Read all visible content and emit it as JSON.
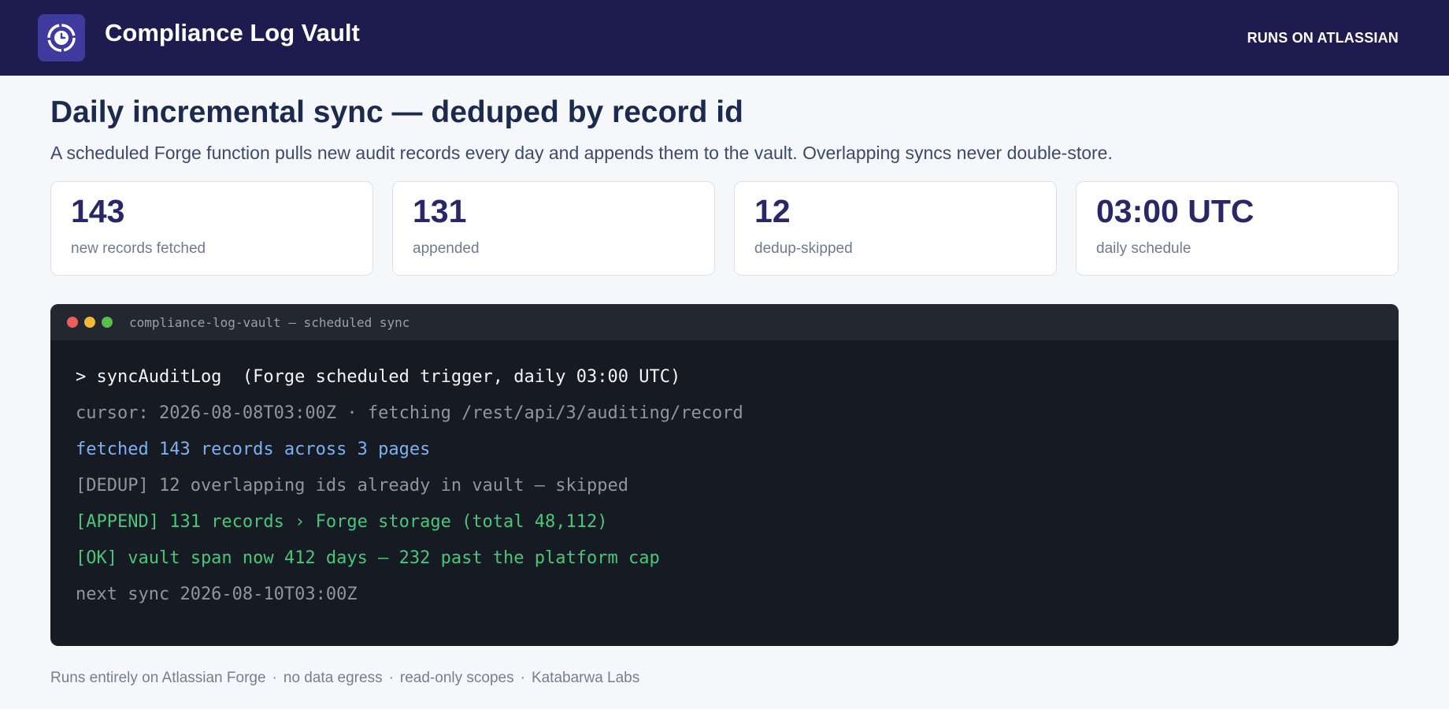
{
  "header": {
    "app_title": "Compliance Log Vault",
    "badge": "RUNS ON ATLASSIAN",
    "logo_icon": "clock-badge-icon",
    "colors": {
      "bar": "#1e1b4f",
      "logo_bg": "#3f3a9e"
    }
  },
  "main": {
    "title": "Daily incremental sync — deduped by record id",
    "subtitle": "A scheduled Forge function pulls new audit records every day and appends them to the vault. Overlapping syncs never double-store."
  },
  "stats": [
    {
      "value": "143",
      "label": "new records fetched"
    },
    {
      "value": "131",
      "label": "appended"
    },
    {
      "value": "12",
      "label": "dedup-skipped"
    },
    {
      "value": "03:00 UTC",
      "label": "daily schedule"
    }
  ],
  "terminal": {
    "title": "compliance-log-vault — scheduled sync",
    "lines": [
      {
        "text": "> syncAuditLog  (Forge scheduled trigger, daily 03:00 UTC)",
        "color": "#f2f4f7"
      },
      {
        "text": "cursor: 2026-08-08T03:00Z · fetching /rest/api/3/auditing/record",
        "color": "#9096a1"
      },
      {
        "text": "fetched 143 records across 3 pages",
        "color": "#7fb0ef"
      },
      {
        "text": "[DEDUP] 12 overlapping ids already in vault — skipped",
        "color": "#9096a1"
      },
      {
        "text": "[APPEND] 131 records › Forge storage (total 48,112)",
        "color": "#48c77a"
      },
      {
        "text": "[OK] vault span now 412 days — 232 past the platform cap",
        "color": "#48c77a"
      },
      {
        "text": "next sync 2026-08-10T03:00Z",
        "color": "#9096a1"
      }
    ]
  },
  "footer": {
    "items": [
      "Runs entirely on Atlassian Forge",
      "no data egress",
      "read-only scopes",
      "Katabarwa Labs"
    ],
    "separator": "·"
  }
}
